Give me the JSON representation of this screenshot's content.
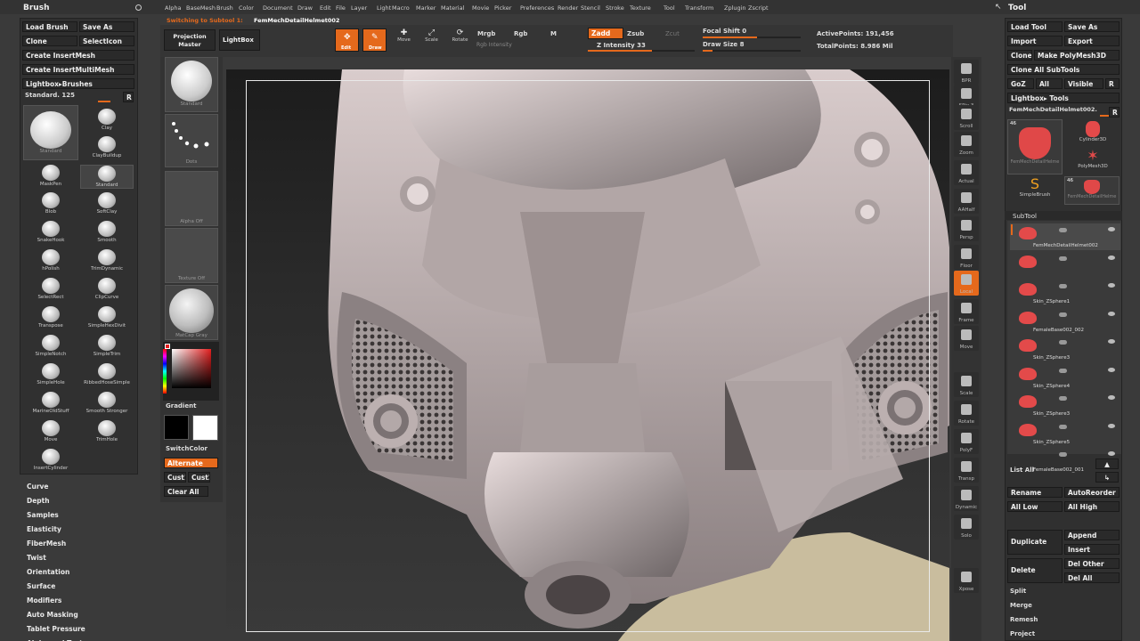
{
  "menu": [
    "Alpha",
    "BaseMesh",
    "Brush",
    "Color",
    "Document",
    "Draw",
    "Edit",
    "File",
    "Layer",
    "Light",
    "Macro",
    "Marker",
    "Material",
    "Movie",
    "Picker",
    "Preferences",
    "Render",
    "Stencil",
    "Stroke",
    "Texture",
    "Tool",
    "Transform",
    "Zplugin",
    "Zscript"
  ],
  "status": {
    "switching": "Switching to Subtool 1:",
    "subtool_name": "FemMechDetailHelmet002"
  },
  "top": {
    "projection_master": "Projection Master",
    "lightbox": "LightBox",
    "edit": "Edit",
    "draw": "Draw",
    "move": "Move",
    "scale": "Scale",
    "rotate": "Rotate",
    "mrgb": "Mrgb",
    "rgb": "Rgb",
    "m": "M",
    "rgb_intensity": "Rgb Intensity",
    "zadd": "Zadd",
    "zsub": "Zsub",
    "zcut": "Zcut",
    "z_intensity": "Z Intensity 33",
    "focal_shift": "Focal Shift 0",
    "draw_size": "Draw Size 8",
    "active_points": "ActivePoints: 191,456",
    "total_points": "TotalPoints: 8.986 Mil"
  },
  "left": {
    "title": "Brush",
    "buttons": {
      "load_brush": "Load Brush",
      "save_as": "Save As",
      "clone": "Clone",
      "select_icon": "SelectIcon",
      "create_insert_mesh": "Create InsertMesh",
      "create_insert_multimesh": "Create InsertMultiMesh",
      "lightbox_brushes": "Lightbox▸Brushes",
      "current": "Standard. 125",
      "r": "R"
    },
    "big_label": "Standard",
    "brushes": [
      "Clay",
      "ClayBuildup",
      "MaskPen",
      "Standard",
      "Blob",
      "SoftClay",
      "SnakeHook",
      "Smooth",
      "hPolish",
      "TrimDynamic",
      "SelectRect",
      "ClipCurve",
      "Transpose",
      "SimpleHexDivit",
      "SimpleNotch",
      "SimpleTrim",
      "SimpleHole",
      "RibbedHoseSimple",
      "MarineOldStuff",
      "Smooth Stronger",
      "Move",
      "TrimHole",
      "InsertCylinder"
    ],
    "sections": [
      "Curve",
      "Depth",
      "Samples",
      "Elasticity",
      "FiberMesh",
      "Twist",
      "Orientation",
      "Surface",
      "Modifiers",
      "Auto Masking",
      "Tablet Pressure",
      "Alpha and Texture"
    ]
  },
  "palette": {
    "brush_thumb": "Standard",
    "stroke_thumb": "Dots",
    "alpha_thumb": "Alpha Off",
    "texture_thumb": "Texture Off",
    "material_thumb": "MatCap Gray",
    "gradient": "Gradient",
    "switch_color": "SwitchColor",
    "alternate": "Alternate",
    "cust1": "Cust1",
    "cust2": "Cust2",
    "clear_all": "Clear All"
  },
  "right_shelf": [
    "BPR",
    "SPix 3",
    "Scroll",
    "Zoom",
    "Actual",
    "AAHalf",
    "Persp",
    "Floor",
    "Local",
    "Frame",
    "Move",
    "Scale",
    "Rotate",
    "PolyF",
    "Transp",
    "Dynamic",
    "Solo",
    "Xpose"
  ],
  "right": {
    "title": "Tool",
    "buttons": {
      "load_tool": "Load Tool",
      "save_as": "Save As",
      "import": "Import",
      "export": "Export",
      "clone": "Clone",
      "make_polymesh": "Make PolyMesh3D",
      "clone_all": "Clone All SubTools",
      "goz": "GoZ",
      "all": "All",
      "visible": "Visible",
      "r": "R",
      "lightbox_tools": "Lightbox▸ Tools",
      "current_tool": "FemMechDetailHelmet002."
    },
    "tools": [
      "FemMechDetailHelme",
      "Cylinder3D",
      "PolyMesh3D",
      "SimpleBrush",
      "FemMechDetailHelme"
    ],
    "tool_count": "46",
    "subtool_title": "SubTool",
    "subtools": [
      "FemMechDetailHelmet002",
      "",
      "Skin_ZSphere1",
      "FemaleBase002_002",
      "Skin_ZSphere3",
      "Skin_ZSphere4",
      "Skin_ZSphere3",
      "Skin_ZSphere5",
      "FemaleBase002_001"
    ],
    "actions": {
      "list_all": "List All",
      "rename": "Rename",
      "auto_reorder": "AutoReorder",
      "all_low": "All Low",
      "all_high": "All High",
      "duplicate": "Duplicate",
      "append": "Append",
      "insert": "Insert",
      "delete": "Delete",
      "del_other": "Del Other",
      "del_all": "Del All",
      "split": "Split",
      "merge": "Merge",
      "remesh": "Remesh",
      "project": "Project"
    }
  },
  "colors": {
    "accent": "#e5691c",
    "bg": "#3a3a3a",
    "panel": "#2a2a2a"
  }
}
